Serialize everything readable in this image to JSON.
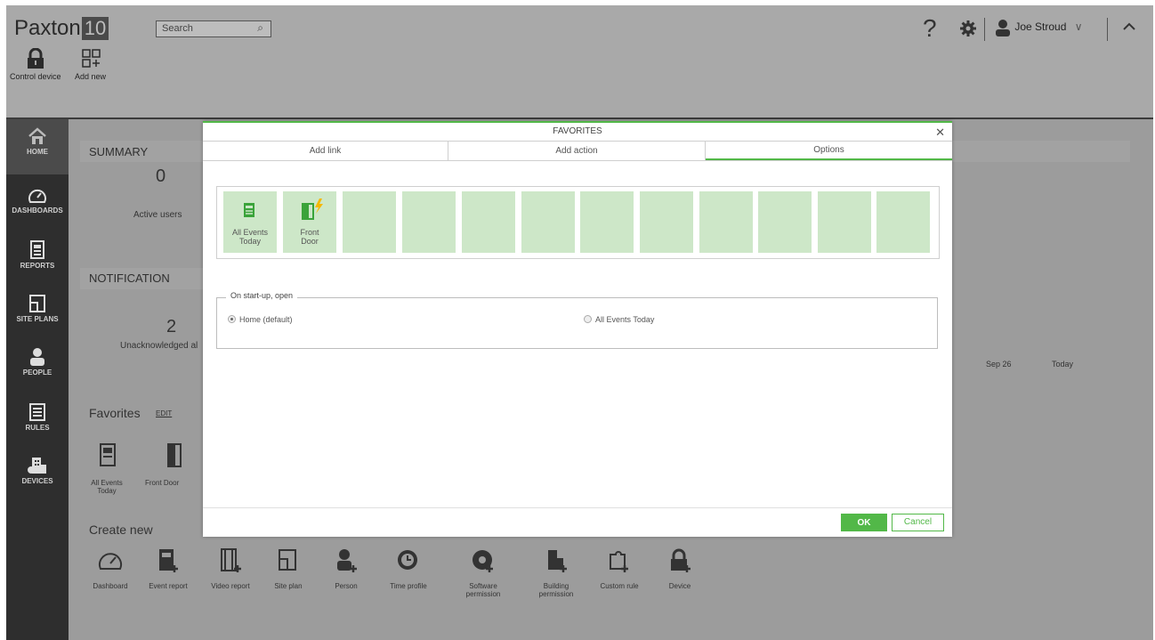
{
  "app": {
    "logo_text": "Paxton",
    "logo_number": "10"
  },
  "search": {
    "placeholder": "Search"
  },
  "toolbar": {
    "control_device": "Control device",
    "add_new": "Add new"
  },
  "header": {
    "help_glyph": "?",
    "user_name": "Joe Stroud"
  },
  "nav": {
    "items": [
      {
        "label": "HOME"
      },
      {
        "label": "DASHBOARDS"
      },
      {
        "label": "REPORTS"
      },
      {
        "label": "SITE PLANS"
      },
      {
        "label": "PEOPLE"
      },
      {
        "label": "RULES"
      },
      {
        "label": "DEVICES"
      }
    ]
  },
  "background": {
    "summary_title": "SUMMARY",
    "active_users_value": "0",
    "active_users_label": "Active users",
    "notification_title": "NOTIFICATION",
    "unack_value": "2",
    "unack_label": "Unacknowledged al",
    "axis_labels": [
      "Sep 26",
      "Today"
    ],
    "favorites_title": "Favorites",
    "favorites_edit": "EDIT",
    "favorites_items": [
      "All Events Today",
      "Front Door"
    ],
    "create_new_title": "Create new",
    "create_items": [
      "Dashboard",
      "Event report",
      "Video report",
      "Site plan",
      "Person",
      "Time profile",
      "Software permission",
      "Building permission",
      "Custom rule",
      "Device"
    ]
  },
  "modal": {
    "title": "FAVORITES",
    "tabs": [
      {
        "label": "Add link"
      },
      {
        "label": "Add action"
      },
      {
        "label": "Options"
      }
    ],
    "active_tab": "Options",
    "favorite_tiles": [
      {
        "label_line1": "All Events",
        "label_line2": "Today",
        "icon": "report-icon"
      },
      {
        "label_line1": "Front",
        "label_line2": "Door",
        "icon": "door-action-icon"
      }
    ],
    "empty_tile_count": 10,
    "startup": {
      "legend": "On start-up, open",
      "options": [
        {
          "label": "Home (default)",
          "selected": true
        },
        {
          "label": "All Events Today",
          "selected": false
        }
      ]
    },
    "ok_label": "OK",
    "cancel_label": "Cancel"
  },
  "colors": {
    "accent": "#52b848",
    "tile": "#cde7c8",
    "nav": "#2e2e2e",
    "overlay": "#9c9c9c"
  }
}
